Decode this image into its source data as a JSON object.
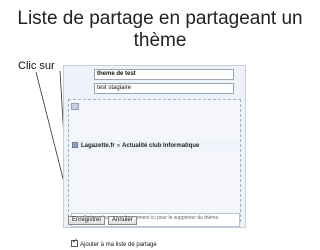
{
  "slide": {
    "title": "Liste de partage en partageant un thème",
    "clic_label": "Clic sur"
  },
  "form": {
    "name_value": "theme de test",
    "description_value": "test stagiaire",
    "shared_item": {
      "source": "Lagazette.fr",
      "separator": "»",
      "category": "Actualité club Informatique"
    },
    "hint_text": "Faites glisser un abonnement ici pour le supprimer du thème.",
    "add_to_share_list_label": "Ajouter à ma liste de partage",
    "add_to_share_list_checked": true,
    "save_label": "Enregistrer",
    "cancel_label": "Annuler"
  }
}
